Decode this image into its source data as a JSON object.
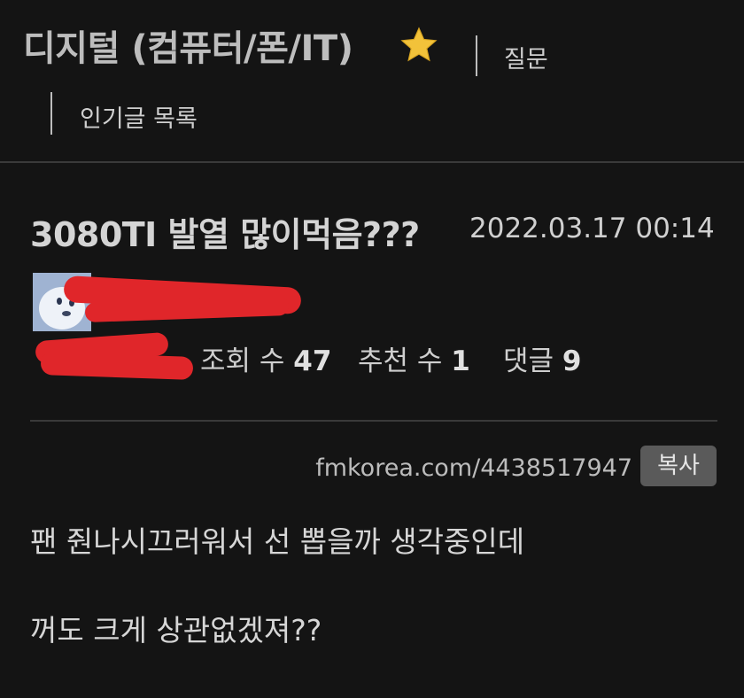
{
  "board": {
    "title": "디지털 (컴퓨터/폰/IT)",
    "favorite_icon": "star-icon",
    "nav_question": "질문",
    "nav_popular": "인기글 목록"
  },
  "post": {
    "title": "3080TI 발열 많이먹음???",
    "date": "2022.03.17 00:14",
    "stats": {
      "views_label": "조회 수",
      "views": "47",
      "recommend_label": "추천 수",
      "recommend": "1",
      "comments_label": "댓글",
      "comments": "9"
    },
    "url": "fmkorea.com/4438517947",
    "copy_label": "복사",
    "body": [
      "팬 줜나시끄러워서 선 뽑을까 생각중인데",
      "꺼도 크게 상관없겠져??"
    ]
  },
  "colors": {
    "background": "#141414",
    "redaction": "#e0262a",
    "star": "#f2c23a"
  }
}
